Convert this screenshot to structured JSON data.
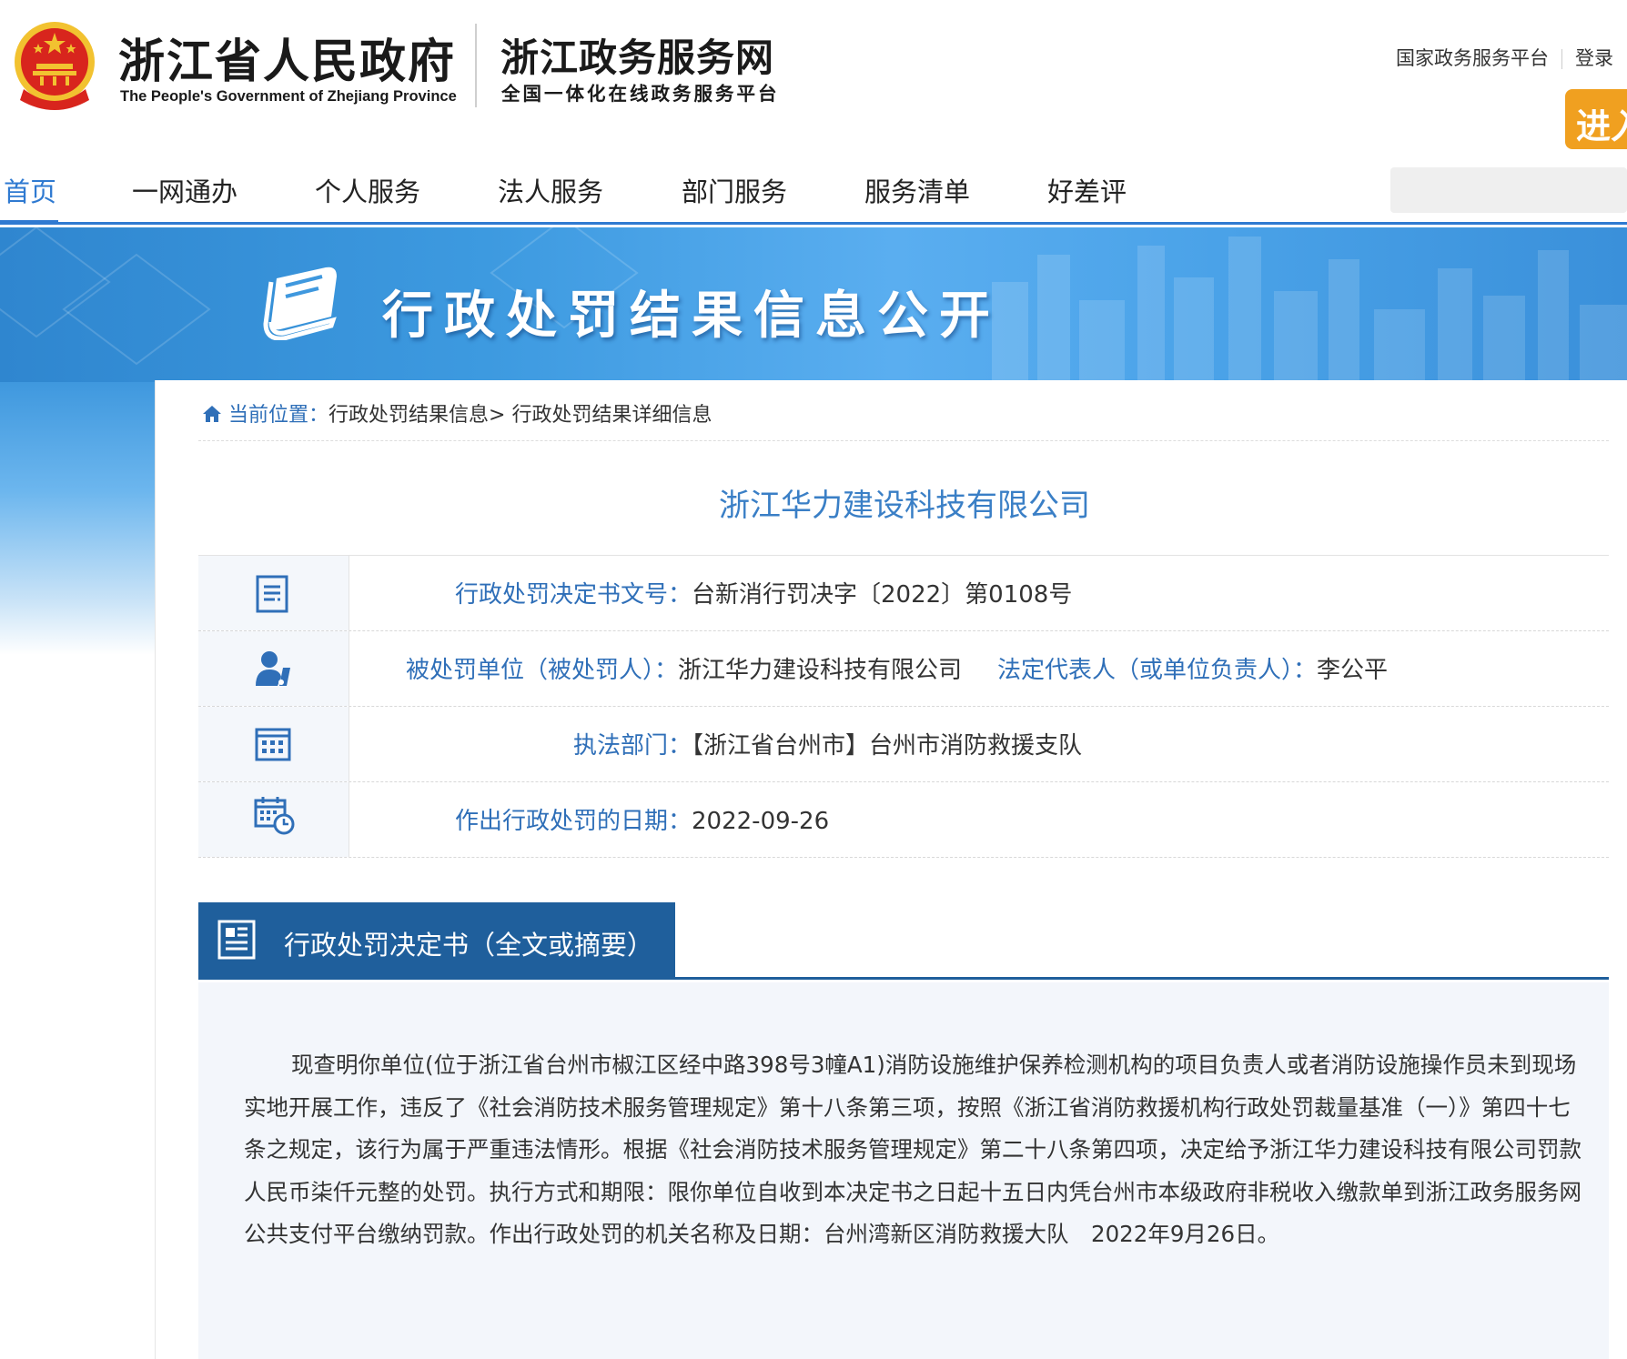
{
  "header": {
    "gov_title": "浙江省人民政府",
    "gov_subtitle": "The People's Government of Zhejiang Province",
    "service_title": "浙江政务服务网",
    "service_subtitle": "全国一体化在线政务服务平台",
    "top_links": [
      "国家政务服务平台",
      "登录"
    ],
    "enter_button": "进入"
  },
  "nav": {
    "items": [
      "首页",
      "一网通办",
      "个人服务",
      "法人服务",
      "部门服务",
      "服务清单",
      "好差评"
    ],
    "active_index": 0
  },
  "banner": {
    "title": "行政处罚结果信息公开"
  },
  "breadcrumb": {
    "current_label": "当前位置",
    "separator": "：",
    "items": [
      "行政处罚结果信息",
      "行政处罚结果详细信息"
    ],
    "arrow": ">"
  },
  "company_title": "浙江华力建设科技有限公司",
  "info": {
    "decision_no_label": "行政处罚决定书文号：",
    "decision_no_value": "台新消行罚决字〔2022〕第0108号",
    "party_label": "被处罚单位（被处罚人）：",
    "party_value": "浙江华力建设科技有限公司",
    "rep_label": "法定代表人（或单位负责人）：",
    "rep_value": "李公平",
    "dept_label": "执法部门：",
    "dept_value": "【浙江省台州市】台州市消防救援支队",
    "date_label": "作出行政处罚的日期：",
    "date_value": "2022-09-26"
  },
  "section": {
    "title": "行政处罚决定书（全文或摘要）",
    "body": "现查明你单位(位于浙江省台州市椒江区经中路398号3幢A1)消防设施维护保养检测机构的项目负责人或者消防设施操作员未到现场实地开展工作，违反了《社会消防技术服务管理规定》第十八条第三项，按照《浙江省消防救援机构行政处罚裁量基准（一）》第四十七条之规定，该行为属于严重违法情形。根据《社会消防技术服务管理规定》第二十八条第四项，决定给予浙江华力建设科技有限公司罚款人民币柒仟元整的处罚。执行方式和期限：限你单位自收到本决定书之日起十五日内凭台州市本级政府非税收入缴款单到浙江政务服务网公共支付平台缴纳罚款。作出行政处罚的机关名称及日期：台州湾新区消防救援大队　2022年9月26日。"
  },
  "colors": {
    "primary_blue": "#2f7ad1",
    "label_blue": "#2f6fb8",
    "section_blue": "#1f5f9c",
    "enter_orange": "#f0a020",
    "emblem_red": "#d8251d",
    "emblem_gold": "#f2c230"
  },
  "icons": [
    "national-emblem-icon",
    "book-icon",
    "home-icon",
    "document-icon",
    "person-icon",
    "building-icon",
    "calendar-clock-icon",
    "form-icon"
  ]
}
